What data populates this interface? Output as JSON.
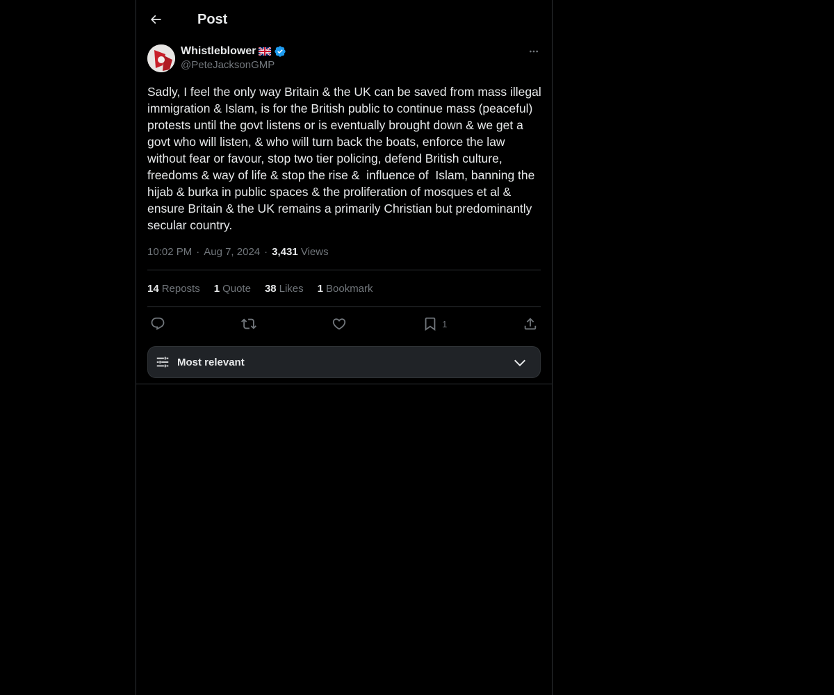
{
  "header": {
    "title": "Post"
  },
  "post": {
    "author": {
      "display_name": "Whistleblower",
      "flag": "uk-flag-emoji",
      "verified": true,
      "handle": "@PeteJacksonGMP"
    },
    "text": "Sadly, I feel the only way Britain & the UK can be saved from mass illegal immigration & Islam, is for the British public to continue mass (peaceful) protests until the govt listens or is eventually brought down & we get a govt who will listen, & who will turn back the boats, enforce the law without fear or favour, stop two tier policing, defend British culture, freedoms & way of life & stop the rise &  influence of  Islam, banning the hijab & burka in public spaces & the proliferation of mosques et al & ensure Britain & the UK remains a primarily Christian but predominantly secular country.",
    "time": "10:02 PM",
    "date": "Aug 7, 2024",
    "views_count": "3,431",
    "views_label": "Views",
    "separator": "·"
  },
  "stats": {
    "reposts_count": "14",
    "reposts_label": "Reposts",
    "quote_count": "1",
    "quote_label": "Quote",
    "likes_count": "38",
    "likes_label": "Likes",
    "bookmark_count": "1",
    "bookmark_label": "Bookmark"
  },
  "actions": {
    "bookmark_count": "1"
  },
  "sort": {
    "label": "Most relevant"
  },
  "colors": {
    "background": "#000000",
    "text": "#e7e9ea",
    "muted": "#71767b",
    "border": "#2f3336",
    "verified": "#1d9bf0"
  }
}
